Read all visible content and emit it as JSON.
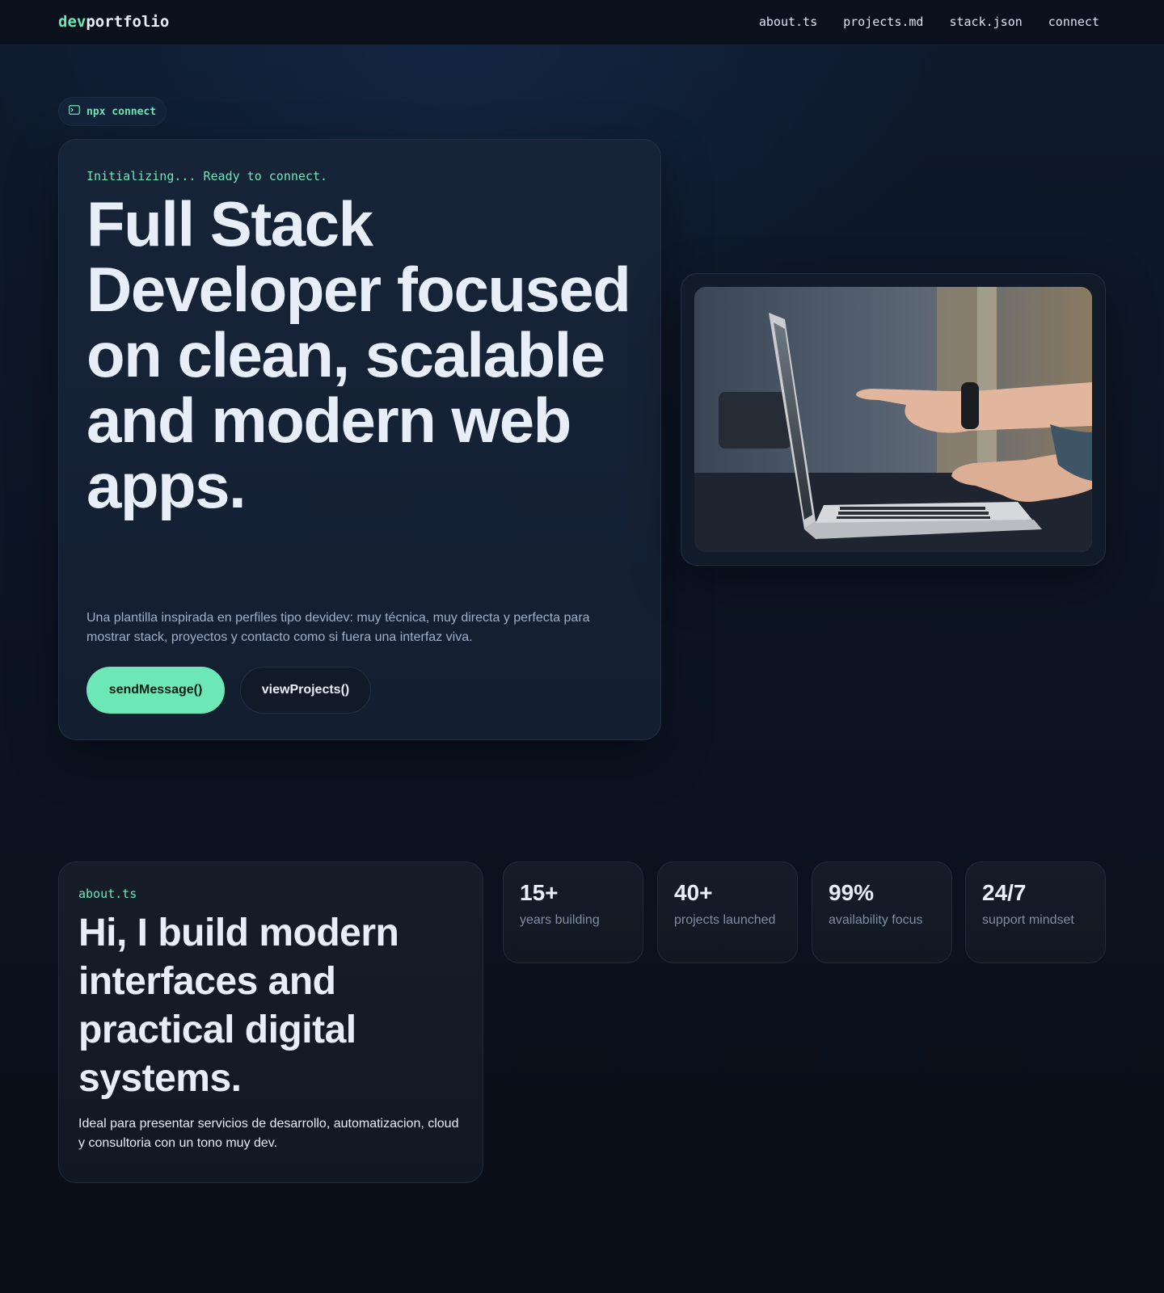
{
  "header": {
    "logo_prefix": "dev",
    "logo_suffix": "portfolio",
    "nav": [
      "about.ts",
      "projects.md",
      "stack.json",
      "connect"
    ]
  },
  "hero": {
    "badge": "npx connect",
    "init": "Initializing... Ready to connect.",
    "title": "Full Stack Developer focused on clean, scalable and modern web apps.",
    "subtitle": "Una plantilla inspirada en perfiles tipo devidev: muy técnica, muy directa y perfecta para mostrar stack, proyectos y contacto como si fuera una interfaz viva.",
    "primary_button": "sendMessage()",
    "secondary_button": "viewProjects()"
  },
  "about": {
    "tag": "about.ts",
    "title": "Hi, I build modern interfaces and practical digital systems.",
    "subtitle": "Ideal para presentar servicios de desarrollo, automatizacion, cloud y consultoria con un tono muy dev."
  },
  "stats": [
    {
      "value": "15+",
      "label": "years building"
    },
    {
      "value": "40+",
      "label": "projects launched"
    },
    {
      "value": "99%",
      "label": "availability focus"
    },
    {
      "value": "24/7",
      "label": "support mindset"
    }
  ],
  "colors": {
    "accent": "#6ee7b7",
    "background": "#0c1524",
    "card": "#172438",
    "muted_text": "#9fb0c8"
  }
}
